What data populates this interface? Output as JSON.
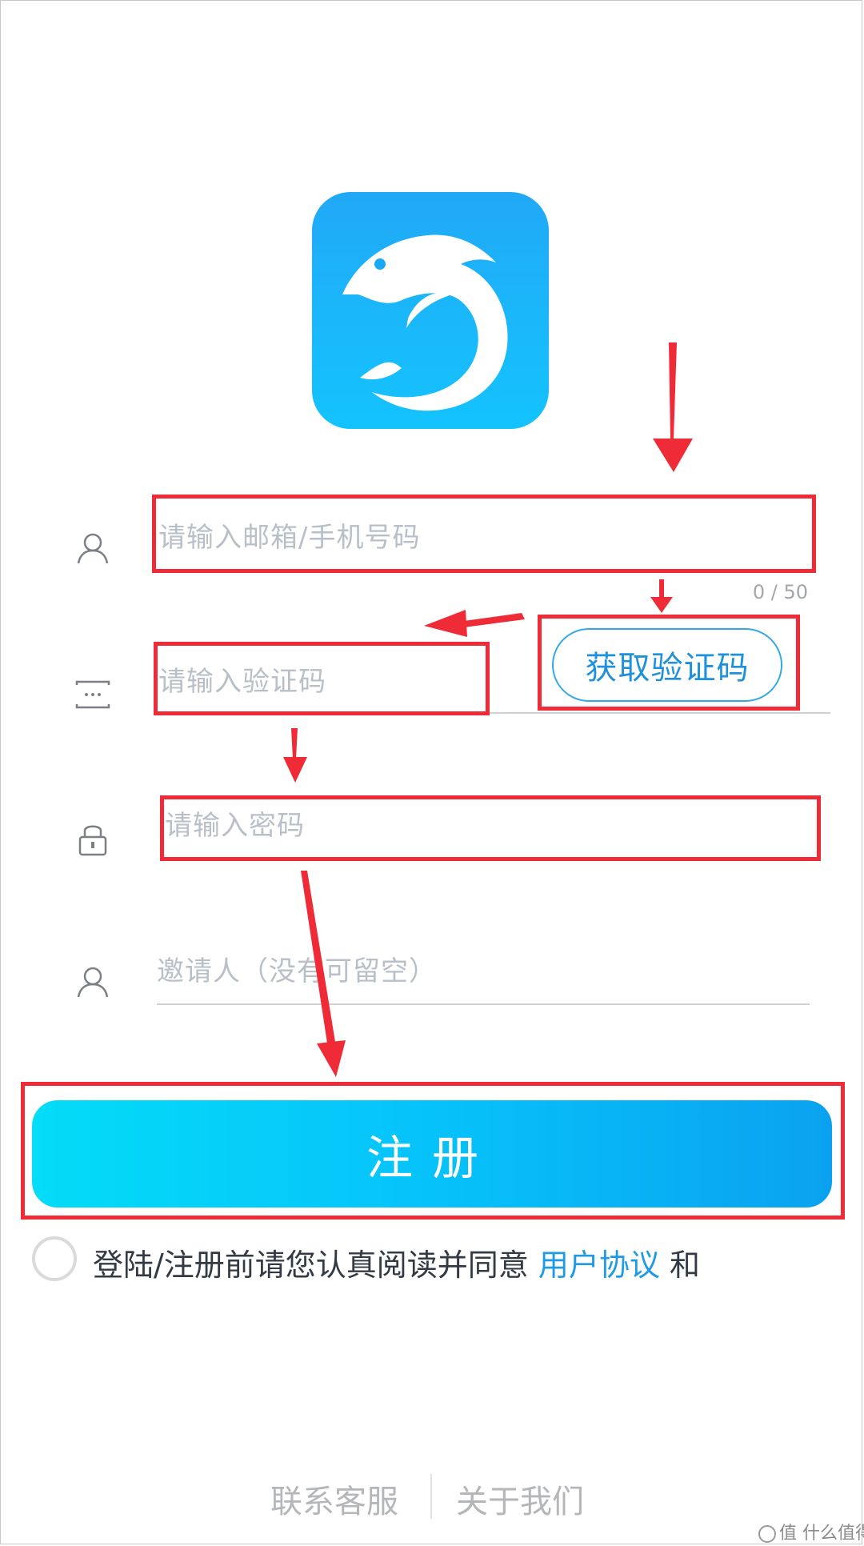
{
  "form": {
    "account_placeholder": "请输入邮箱/手机号码",
    "account_counter": "0 / 50",
    "code_placeholder": "请输入验证码",
    "get_code_label": "获取验证码",
    "password_placeholder": "请输入密码",
    "inviter_placeholder": "邀请人（没有可留空）",
    "register_label": "注册"
  },
  "agreement": {
    "prefix": "登陆/注册前请您认真阅读并同意",
    "link": "用户协议",
    "suffix": "和"
  },
  "footer": {
    "contact": "联系客服",
    "about": "关于我们"
  },
  "watermark": "值 什么值得买",
  "icons": {
    "logo": "dolphin-logo",
    "account": "user-icon",
    "code": "message-code-icon",
    "password": "lock-icon",
    "inviter": "user-icon"
  },
  "colors": {
    "accent": "#1f9be6",
    "annotation": "#ee2b37"
  }
}
